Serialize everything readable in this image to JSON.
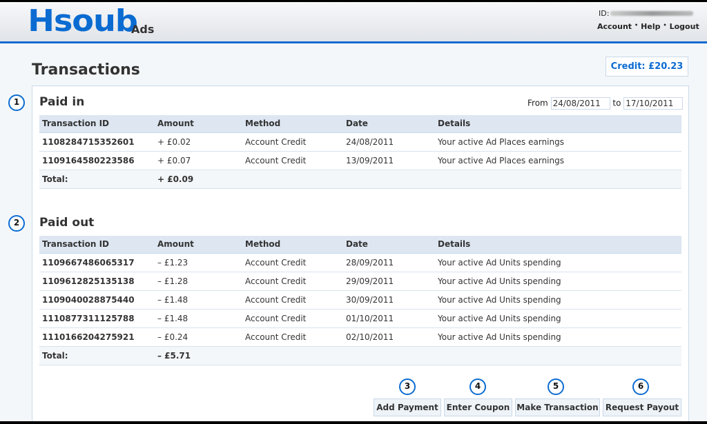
{
  "header": {
    "logo": "Hsoub",
    "logo_sub": "Ads",
    "id_label": "ID:",
    "links": [
      "Account",
      "Help",
      "Logout"
    ]
  },
  "page_title": "Transactions",
  "credit": "Credit: £20.23",
  "filter": {
    "from_label": "From",
    "from": "24/08/2011",
    "to_label": "to",
    "to": "17/10/2011"
  },
  "columns": [
    "Transaction ID",
    "Amount",
    "Method",
    "Date",
    "Details"
  ],
  "paid_in": {
    "title": "Paid in",
    "marker": "1",
    "rows": [
      [
        "1108284715352601",
        "+ £0.02",
        "Account Credit",
        "24/08/2011",
        "Your active Ad Places earnings"
      ],
      [
        "1109164580223586",
        "+ £0.07",
        "Account Credit",
        "13/09/2011",
        "Your active Ad Places earnings"
      ]
    ],
    "total_label": "Total:",
    "total": "+ £0.09"
  },
  "paid_out": {
    "title": "Paid out",
    "marker": "2",
    "rows": [
      [
        "1109667486065317",
        "– £1.23",
        "Account Credit",
        "28/09/2011",
        "Your active Ad Units spending"
      ],
      [
        "1109612825135138",
        "– £1.28",
        "Account Credit",
        "29/09/2011",
        "Your active Ad Units spending"
      ],
      [
        "1109040028875440",
        "– £1.48",
        "Account Credit",
        "30/09/2011",
        "Your active Ad Units spending"
      ],
      [
        "1110877311125788",
        "– £1.48",
        "Account Credit",
        "01/10/2011",
        "Your active Ad Units spending"
      ],
      [
        "1110166204275921",
        "– £0.24",
        "Account Credit",
        "02/10/2011",
        "Your active Ad Units spending"
      ]
    ],
    "total_label": "Total:",
    "total": "– £5.71"
  },
  "buttons": [
    {
      "label": "Add Payment",
      "marker": "3"
    },
    {
      "label": "Enter Coupon",
      "marker": "4"
    },
    {
      "label": "Make Transaction",
      "marker": "5"
    },
    {
      "label": "Request Payout",
      "marker": "6"
    }
  ],
  "colors": {
    "accent": "#0b6bd1",
    "table_header": "#dde6f1"
  }
}
